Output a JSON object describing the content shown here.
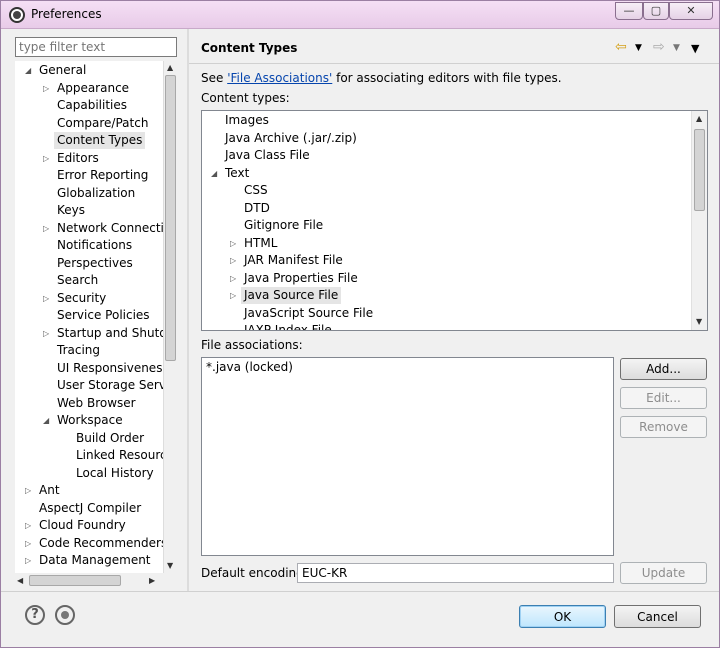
{
  "window": {
    "title": "Preferences",
    "controls": [
      "—",
      "▢",
      "✕"
    ]
  },
  "filter": {
    "placeholder": "type filter text"
  },
  "tree": {
    "rows": [
      {
        "label": "General",
        "level": 0,
        "twisty": "open"
      },
      {
        "label": "Appearance",
        "level": 1,
        "twisty": "closed"
      },
      {
        "label": "Capabilities",
        "level": 1,
        "twisty": ""
      },
      {
        "label": "Compare/Patch",
        "level": 1,
        "twisty": ""
      },
      {
        "label": "Content Types",
        "level": 1,
        "twisty": "",
        "selected": true
      },
      {
        "label": "Editors",
        "level": 1,
        "twisty": "closed"
      },
      {
        "label": "Error Reporting",
        "level": 1,
        "twisty": ""
      },
      {
        "label": "Globalization",
        "level": 1,
        "twisty": ""
      },
      {
        "label": "Keys",
        "level": 1,
        "twisty": ""
      },
      {
        "label": "Network Connection",
        "level": 1,
        "twisty": "closed"
      },
      {
        "label": "Notifications",
        "level": 1,
        "twisty": ""
      },
      {
        "label": "Perspectives",
        "level": 1,
        "twisty": ""
      },
      {
        "label": "Search",
        "level": 1,
        "twisty": ""
      },
      {
        "label": "Security",
        "level": 1,
        "twisty": "closed"
      },
      {
        "label": "Service Policies",
        "level": 1,
        "twisty": ""
      },
      {
        "label": "Startup and Shutdo",
        "level": 1,
        "twisty": "closed"
      },
      {
        "label": "Tracing",
        "level": 1,
        "twisty": ""
      },
      {
        "label": "UI Responsiveness M",
        "level": 1,
        "twisty": ""
      },
      {
        "label": "User Storage Service",
        "level": 1,
        "twisty": ""
      },
      {
        "label": "Web Browser",
        "level": 1,
        "twisty": ""
      },
      {
        "label": "Workspace",
        "level": 1,
        "twisty": "open"
      },
      {
        "label": "Build Order",
        "level": 2,
        "twisty": ""
      },
      {
        "label": "Linked Resource",
        "level": 2,
        "twisty": ""
      },
      {
        "label": "Local History",
        "level": 2,
        "twisty": ""
      },
      {
        "label": "Ant",
        "level": 0,
        "twisty": "closed"
      },
      {
        "label": "AspectJ Compiler",
        "level": 0,
        "twisty": ""
      },
      {
        "label": "Cloud Foundry",
        "level": 0,
        "twisty": "closed"
      },
      {
        "label": "Code Recommenders",
        "level": 0,
        "twisty": "closed"
      },
      {
        "label": "Data Management",
        "level": 0,
        "twisty": "closed"
      }
    ]
  },
  "page": {
    "title": "Content Types",
    "see_prefix": "See ",
    "see_link": "'File Associations'",
    "see_suffix": " for associating editors with file types.",
    "content_types_label": "Content types:",
    "file_assoc_label": "File associations:",
    "encoding_label": "Default encoding:",
    "encoding_value": "EUC-KR"
  },
  "content_types": [
    {
      "label": "Images",
      "level": 0,
      "twisty": ""
    },
    {
      "label": "Java Archive (.jar/.zip)",
      "level": 0,
      "twisty": ""
    },
    {
      "label": "Java Class File",
      "level": 0,
      "twisty": ""
    },
    {
      "label": "Text",
      "level": 0,
      "twisty": "open"
    },
    {
      "label": "CSS",
      "level": 1,
      "twisty": ""
    },
    {
      "label": "DTD",
      "level": 1,
      "twisty": ""
    },
    {
      "label": "Gitignore File",
      "level": 1,
      "twisty": ""
    },
    {
      "label": "HTML",
      "level": 1,
      "twisty": "closed"
    },
    {
      "label": "JAR Manifest File",
      "level": 1,
      "twisty": "closed"
    },
    {
      "label": "Java Properties File",
      "level": 1,
      "twisty": "closed"
    },
    {
      "label": "Java Source File",
      "level": 1,
      "twisty": "closed",
      "selected": true
    },
    {
      "label": "JavaScript Source File",
      "level": 1,
      "twisty": ""
    },
    {
      "label": "JAXP Index File",
      "level": 1,
      "twisty": ""
    }
  ],
  "associations": [
    "*.java (locked)"
  ],
  "buttons": {
    "add": "Add...",
    "edit": "Edit...",
    "remove": "Remove",
    "update": "Update",
    "ok": "OK",
    "cancel": "Cancel"
  },
  "icons": {
    "help": "?",
    "back": "⇦",
    "forward": "⇨",
    "menu_arrow": "▼"
  }
}
